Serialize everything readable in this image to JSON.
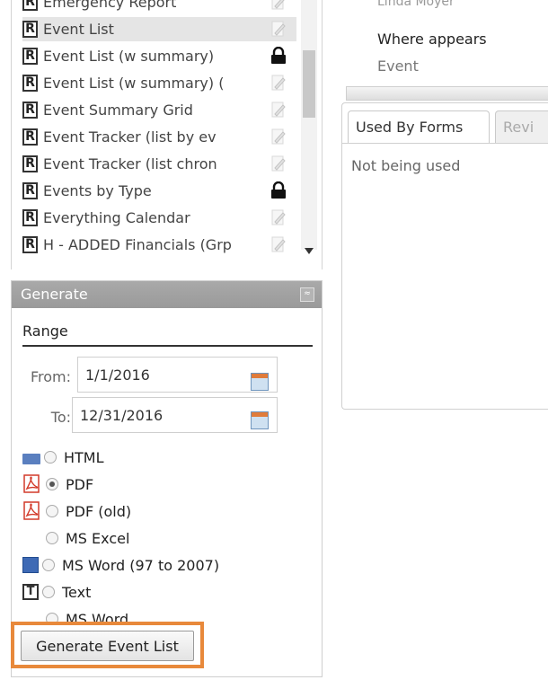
{
  "report_list": {
    "items": [
      {
        "label": "Emergency Report",
        "action": "edit"
      },
      {
        "label": "Event List",
        "action": "edit",
        "selected": true
      },
      {
        "label": "Event List (w summary)",
        "action": "lock"
      },
      {
        "label": "Event List (w summary) (",
        "action": "edit"
      },
      {
        "label": "Event Summary Grid",
        "action": "edit"
      },
      {
        "label": "Event Tracker (list by ev",
        "action": "edit"
      },
      {
        "label": "Event Tracker (list chron",
        "action": "edit"
      },
      {
        "label": "Events by Type",
        "action": "lock"
      },
      {
        "label": "Everything Calendar",
        "action": "edit"
      },
      {
        "label": "H - ADDED Financials (Grp",
        "action": "edit"
      }
    ],
    "type_letter": "R"
  },
  "generate": {
    "title": "Generate",
    "collapse_symbol": "≈",
    "range_title": "Range",
    "from_label": "From:",
    "from_value": "1/1/2016",
    "to_label": "To:",
    "to_value": "12/31/2016",
    "formats": [
      {
        "label": "HTML",
        "icon": "html-icon",
        "checked": false
      },
      {
        "label": "PDF",
        "icon": "pdf-icon",
        "checked": true
      },
      {
        "label": "PDF (old)",
        "icon": "pdf-icon",
        "checked": false
      },
      {
        "label": "MS Excel",
        "icon": "",
        "checked": false
      },
      {
        "label": "MS Word (97 to 2007)",
        "icon": "word-icon",
        "checked": false
      },
      {
        "label": "Text",
        "icon": "text-icon",
        "checked": false
      },
      {
        "label": "MS Word",
        "icon": "",
        "checked": false
      }
    ],
    "button_label": "Generate Event List"
  },
  "detail": {
    "cut_name": "Linda Moyer",
    "where_label": "Where appears",
    "where_value": "Event",
    "tabs": [
      "Used By Forms",
      "Revi"
    ],
    "used_status": "Not being used"
  },
  "colors": {
    "highlight": "#e8893b",
    "header_bg": "#9f9f9f",
    "pdf_red": "#d23a2a"
  }
}
